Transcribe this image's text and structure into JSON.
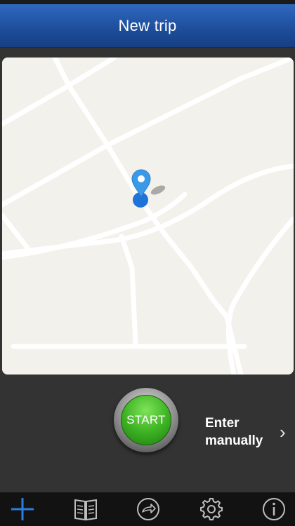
{
  "header": {
    "title": "New trip"
  },
  "controls": {
    "start_label": "START",
    "enter_manually_line1": "Enter",
    "enter_manually_line2": "manually"
  },
  "tabbar": {
    "tabs": [
      {
        "icon": "plus-icon",
        "active": true
      },
      {
        "icon": "book-icon",
        "active": false
      },
      {
        "icon": "forward-arrow-icon",
        "active": false
      },
      {
        "icon": "gear-icon",
        "active": false
      },
      {
        "icon": "info-icon",
        "active": false
      }
    ]
  },
  "colors": {
    "navbar": "#1d4d9a",
    "start_green": "#3fb524",
    "active_tab": "#2a7de1",
    "pin_blue": "#2a8be6"
  }
}
